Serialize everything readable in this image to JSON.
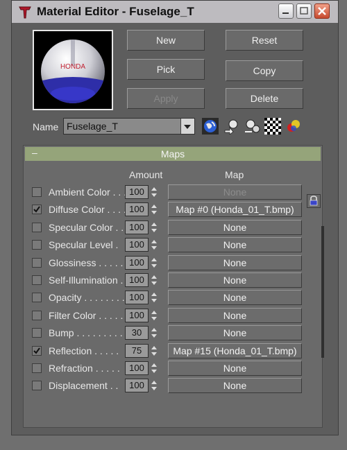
{
  "window": {
    "title": "Material Editor - Fuselage_T"
  },
  "buttons": {
    "new": "New",
    "reset": "Reset",
    "pick": "Pick",
    "copy": "Copy",
    "apply": "Apply",
    "delete": "Delete"
  },
  "name": {
    "label": "Name",
    "value": "Fuselage_T"
  },
  "maps": {
    "header": "Maps",
    "minus": "–",
    "col_amount": "Amount",
    "col_map": "Map",
    "rows": [
      {
        "label": "Ambient Color . . .",
        "checked": false,
        "amount": "100",
        "map": "None",
        "disabled": true
      },
      {
        "label": "Diffuse Color . . . .",
        "checked": true,
        "amount": "100",
        "map": "Map #0 (Honda_01_T.bmp)"
      },
      {
        "label": "Specular Color . .",
        "checked": false,
        "amount": "100",
        "map": "None"
      },
      {
        "label": "Specular Level .",
        "checked": false,
        "amount": "100",
        "map": "None"
      },
      {
        "label": "Glossiness . . . . .",
        "checked": false,
        "amount": "100",
        "map": "None"
      },
      {
        "label": "Self-Illumination .",
        "checked": false,
        "amount": "100",
        "map": "None"
      },
      {
        "label": "Opacity . . . . . . . .",
        "checked": false,
        "amount": "100",
        "map": "None"
      },
      {
        "label": "Filter Color . . . . .",
        "checked": false,
        "amount": "100",
        "map": "None"
      },
      {
        "label": "Bump . . . . . . . . .",
        "checked": false,
        "amount": "30",
        "map": "None"
      },
      {
        "label": "Reflection . . . . .",
        "checked": true,
        "amount": "75",
        "map": "Map #15 (Honda_01_T.bmp)"
      },
      {
        "label": "Refraction . . . . .",
        "checked": false,
        "amount": "100",
        "map": "None"
      },
      {
        "label": "Displacement . .",
        "checked": false,
        "amount": "100",
        "map": "None"
      }
    ]
  },
  "preview": {
    "sphere_text": "HONDA"
  },
  "icons": [
    "material-editor-app-icon",
    "minimize-icon",
    "maximize-icon",
    "close-icon",
    "globe-icon",
    "get-material-icon",
    "put-material-icon",
    "checker-background-icon",
    "color-balls-icon",
    "lock-icon",
    "spinner-arrows-icon",
    "checkmark-icon"
  ]
}
